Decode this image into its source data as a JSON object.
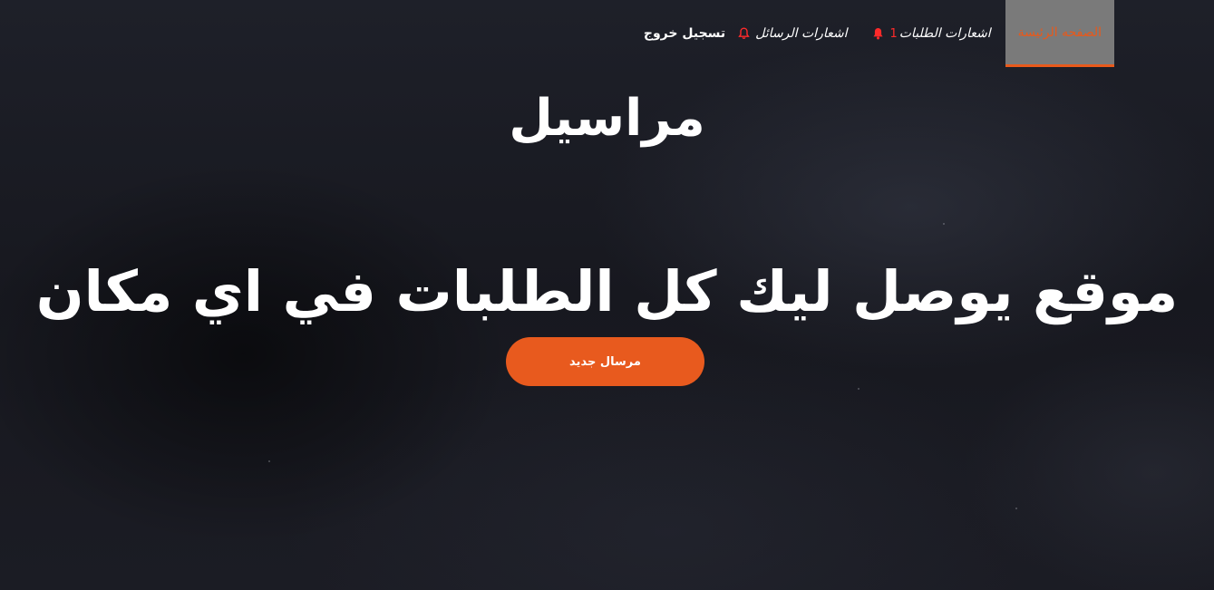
{
  "nav": {
    "logout_label": "تسجيل خروج",
    "messages_notifications_label": "اشعارات الرسائل",
    "orders_notifications_label": "اشعارات الطلبات",
    "orders_notifications_count": "1",
    "home_label": "الصفحه الرئيسة"
  },
  "hero": {
    "brand_title": "مراسيل",
    "tagline": "موقع يوصل ليك كل الطلبات في اي مكان",
    "new_courier_button": "مرسال جديد"
  },
  "colors": {
    "accent": "#e85a1e",
    "active_tab_bg": "#7a7a7a",
    "notification_red": "#ff2a2a",
    "background": "#161820"
  }
}
